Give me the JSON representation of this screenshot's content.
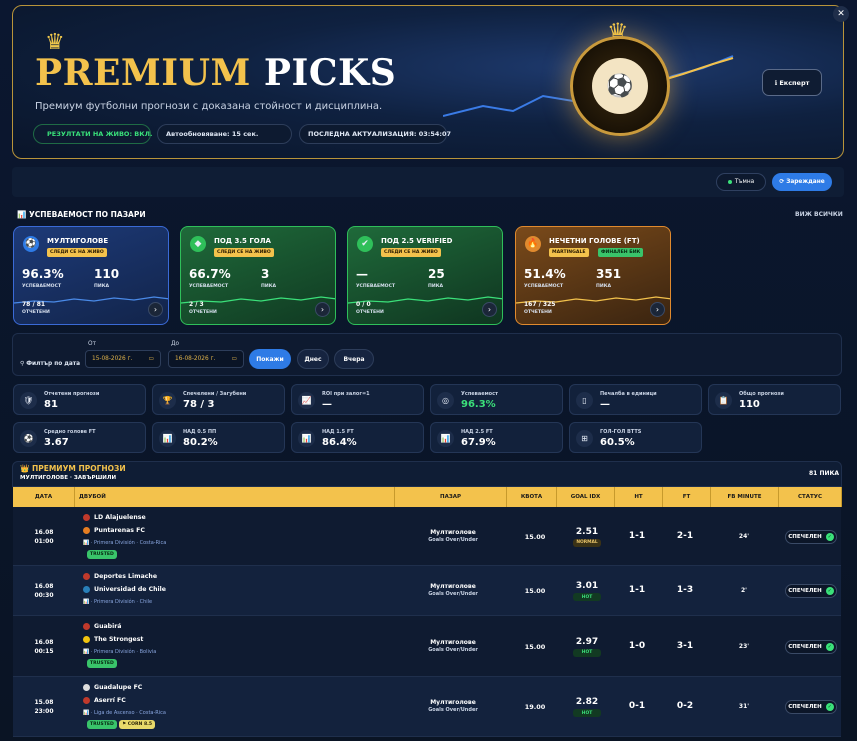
{
  "hero": {
    "title_gold": "PREMIUM",
    "title_white": "PICKS",
    "subtitle": "Премиум футболни прогнози с доказана стойност и дисциплина.",
    "chip_live": "РЕЗУЛТАТИ НА ЖИВО: ВКЛ.",
    "chip_auto": "Автообновяване: 15 сек.",
    "chip_updated": "ПОСЛЕДНА АКТУАЛИЗАЦИЯ: 03:54:07",
    "expert_label": "ℹ Експерт",
    "close_label": "✕"
  },
  "toolbar": {
    "theme_label": "Тъмна",
    "reload_label": "⟳ Зареждане"
  },
  "markets_section": {
    "title": "📊 УСПЕВАЕМОСТ ПО ПАЗАРИ",
    "see_all": "ВИЖ ВСИЧКИ"
  },
  "market_cards": [
    {
      "name": "МУЛТИГОЛОВЕ",
      "tag": "СЛЕДИ СЕ НА ЖИВО",
      "rate": "96.3%",
      "picks": "110",
      "rate_label": "УСПЕВАЕМОСТ",
      "picks_label": "ПИКА",
      "ratio": "78 / 81",
      "ratio_label": "ОТЧЕТЕНИ",
      "arrow": "›",
      "icon": "soccer-ball-icon",
      "color": "#2e7be6"
    },
    {
      "name": "ПОД 3.5 ГОЛА",
      "tag": "СЛЕДИ СЕ НА ЖИВО",
      "rate": "66.7%",
      "picks": "3",
      "rate_label": "УСПЕВАЕМОСТ",
      "picks_label": "ПИКА",
      "ratio": "2 / 3",
      "ratio_label": "ОТЧЕТЕНИ",
      "arrow": "›",
      "icon": "cube-icon",
      "color": "#2fbf5a"
    },
    {
      "name": "ПОД 2.5 VERIFIED",
      "tag": "СЛЕДИ СЕ НА ЖИВО",
      "rate": "—",
      "picks": "25",
      "rate_label": "УСПЕВАЕМОСТ",
      "picks_label": "ПИКА",
      "ratio": "0 / 0",
      "ratio_label": "ОТЧЕТЕНИ",
      "arrow": "›",
      "icon": "check-box-icon",
      "color": "#2fbf5a"
    },
    {
      "name": "НЕЧЕТНИ ГОЛОВЕ (FT)",
      "tag": "MARTINGALE",
      "tag2": "ФИНАЛЕН БИК",
      "rate": "51.4%",
      "picks": "351",
      "rate_label": "УСПЕВАЕМОСТ",
      "picks_label": "ПИКА",
      "ratio": "167 / 325",
      "ratio_label": "ОТЧЕТЕНИ",
      "arrow": "›",
      "icon": "flame-icon",
      "color": "#e08a2e"
    }
  ],
  "filter": {
    "label": "⚲ Филтър по дата",
    "from_label": "От",
    "to_label": "До",
    "from_value": "15-08-2026 г.",
    "to_value": "16-08-2026 г.",
    "show": "Покажи",
    "today": "Днес",
    "yesterday": "Вчера"
  },
  "stats": [
    {
      "label": "Отчетени прогнози",
      "value": "81",
      "icon": "shield-icon"
    },
    {
      "label": "Спечелени / Загубени",
      "value": "78 / 3",
      "icon": "trophy-icon"
    },
    {
      "label": "ROI при залог=1",
      "value": "—",
      "icon": "chart-icon"
    },
    {
      "label": "Успеваемост",
      "value": "96.3%",
      "icon": "target-icon"
    },
    {
      "label": "Печалба в единици",
      "value": "—",
      "icon": "coin-icon"
    },
    {
      "label": "Общо прогнози",
      "value": "110",
      "icon": "clipboard-icon"
    },
    {
      "label": "Средно голове FT",
      "value": "3.67",
      "icon": "soccer-ball-icon"
    },
    {
      "label": "НАД 0.5 ПП",
      "value": "80.2%",
      "icon": "bar-chart-icon"
    },
    {
      "label": "НАД 1.5 FT",
      "value": "86.4%",
      "icon": "bar-chart-icon"
    },
    {
      "label": "НАД 2.5 FT",
      "value": "67.9%",
      "icon": "bar-chart-icon"
    },
    {
      "label": "ГОЛ-ГОЛ BTTS",
      "value": "60.5%",
      "icon": "goal-icon"
    }
  ],
  "table": {
    "title": "👑 ПРЕМИУМ ПРОГНОЗИ",
    "subtitle": "МУЛТИГОЛОВЕ · ЗАВЪРШИЛИ",
    "count": "81 ПИКА",
    "headers": [
      "ДАТА",
      "ДВУБОЙ",
      "ПАЗАР",
      "КВОТА",
      "GOAL IDX",
      "HT",
      "FT",
      "FB MINUTE",
      "СТАТУС"
    ],
    "rows": [
      {
        "date": "16.08",
        "time": "01:00",
        "home": "LD Alajuelense",
        "away": "Puntarenas FC",
        "league": "· Primera División · Costa-Rica",
        "trusted": "TRUSTED",
        "market": "Мултиголове",
        "market_sub": "Goals Over/Under",
        "odd": "15.00",
        "gidx": "2.51",
        "gidx_tag": "NORMAL",
        "ht": "1-1",
        "ft": "2-1",
        "fbm": "24'",
        "status": "СПЕЧЕЛЕН"
      },
      {
        "date": "16.08",
        "time": "00:30",
        "home": "Deportes Limache",
        "away": "Universidad de Chile",
        "league": "· Primera División · Chile",
        "trusted": "",
        "market": "Мултиголове",
        "market_sub": "Goals Over/Under",
        "odd": "15.00",
        "gidx": "3.01",
        "gidx_tag": "HOT",
        "ht": "1-1",
        "ft": "1-3",
        "fbm": "2'",
        "status": "СПЕЧЕЛЕН"
      },
      {
        "date": "16.08",
        "time": "00:15",
        "home": "Guabirá",
        "away": "The Strongest",
        "league": "· Primera División · Bolivia",
        "trusted": "TRUSTED",
        "market": "Мултиголове",
        "market_sub": "Goals Over/Under",
        "odd": "15.00",
        "gidx": "2.97",
        "gidx_tag": "HOT",
        "ht": "1-0",
        "ft": "3-1",
        "fbm": "23'",
        "status": "СПЕЧЕЛЕН"
      },
      {
        "date": "15.08",
        "time": "23:00",
        "home": "Guadalupe FC",
        "away": "Aserrí FC",
        "league": "· Liga de Ascenso · Costa-Rica",
        "trusted": "TRUSTED",
        "corn": "⚑ CORN 8.5",
        "market": "Мултиголове",
        "market_sub": "Goals Over/Under",
        "odd": "19.00",
        "gidx": "2.82",
        "gidx_tag": "HOT",
        "ht": "0-1",
        "ft": "0-2",
        "fbm": "31'",
        "status": "СПЕЧЕЛЕН"
      }
    ]
  }
}
